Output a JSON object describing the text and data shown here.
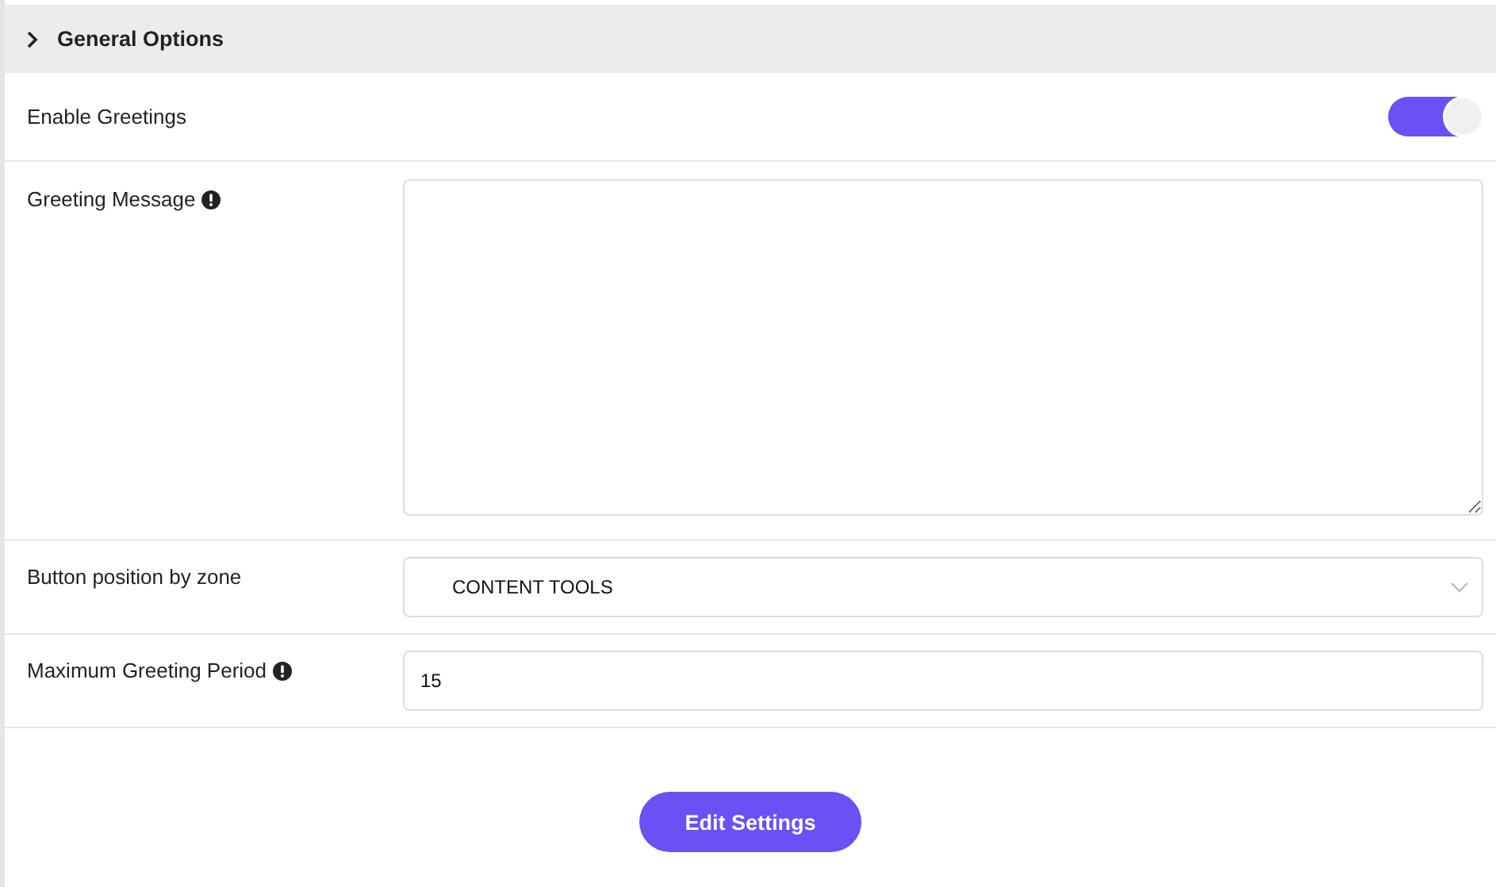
{
  "section": {
    "title": "General Options",
    "expanded": false
  },
  "rows": [
    {
      "kind": "toggle",
      "label": "Enable Greetings",
      "info": false,
      "on": true
    },
    {
      "kind": "textarea",
      "label": "Greeting Message",
      "info": true
    },
    {
      "kind": "select",
      "label": "Button position by zone",
      "info": false,
      "value": "CONTENT TOOLS"
    },
    {
      "kind": "text",
      "label": "Maximum Greeting Period",
      "info": true,
      "value": "15"
    }
  ],
  "button": "Edit Settings"
}
